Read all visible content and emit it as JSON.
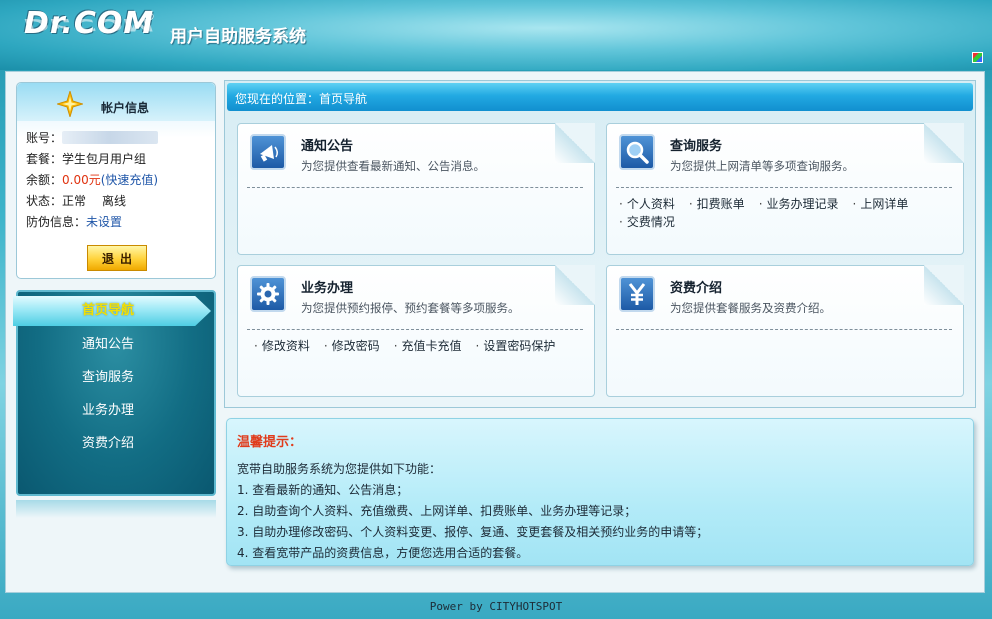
{
  "header": {
    "logo_text": "Dr.COM",
    "logo_reg": "®",
    "system_title": "用户自助服务系统"
  },
  "account": {
    "title": "帐户信息",
    "account_label": "账号：",
    "package_label": "套餐：",
    "package_value": "学生包月用户组",
    "balance_label": "余额：",
    "balance_value": "0.00元",
    "recharge_link": "(快速充值)",
    "status_label": "状态：",
    "status_value": "正常",
    "online_value": "离线",
    "security_label": "防伪信息：",
    "security_value": "未设置",
    "logout_label": "退出"
  },
  "nav": {
    "items": [
      {
        "label": "首页导航",
        "active": true
      },
      {
        "label": "通知公告",
        "active": false
      },
      {
        "label": "查询服务",
        "active": false
      },
      {
        "label": "业务办理",
        "active": false
      },
      {
        "label": "资费介绍",
        "active": false
      }
    ]
  },
  "breadcrumb": "您现在的位置：首页导航",
  "cards": [
    {
      "title": "通知公告",
      "desc": "为您提供查看最新通知、公告消息。",
      "icon": "megaphone-icon",
      "links": []
    },
    {
      "title": "查询服务",
      "desc": "为您提供上网清单等多项查询服务。",
      "icon": "magnifier-icon",
      "links": [
        "个人资料",
        "扣费账单",
        "业务办理记录",
        "上网详单",
        "交费情况"
      ]
    },
    {
      "title": "业务办理",
      "desc": "为您提供预约报停、预约套餐等多项服务。",
      "icon": "gear-icon",
      "links": [
        "修改资料",
        "修改密码",
        "充值卡充值",
        "设置密码保护"
      ]
    },
    {
      "title": "资费介绍",
      "desc": "为您提供套餐服务及资费介绍。",
      "icon": "yen-icon",
      "links": []
    }
  ],
  "tips": {
    "title": "温馨提示：",
    "lines": [
      "宽带自助服务系统为您提供如下功能：",
      "1. 查看最新的通知、公告消息；",
      "2. 自助查询个人资料、充值缴费、上网详单、扣费账单、业务办理等记录；",
      "3. 自助办理修改密码、个人资料变更、报停、复通、变更套餐及相关预约业务的申请等；",
      "4. 查看宽带产品的资费信息，方便您选用合适的套餐。"
    ]
  },
  "footer": "Power by CITYHOTSPOT"
}
